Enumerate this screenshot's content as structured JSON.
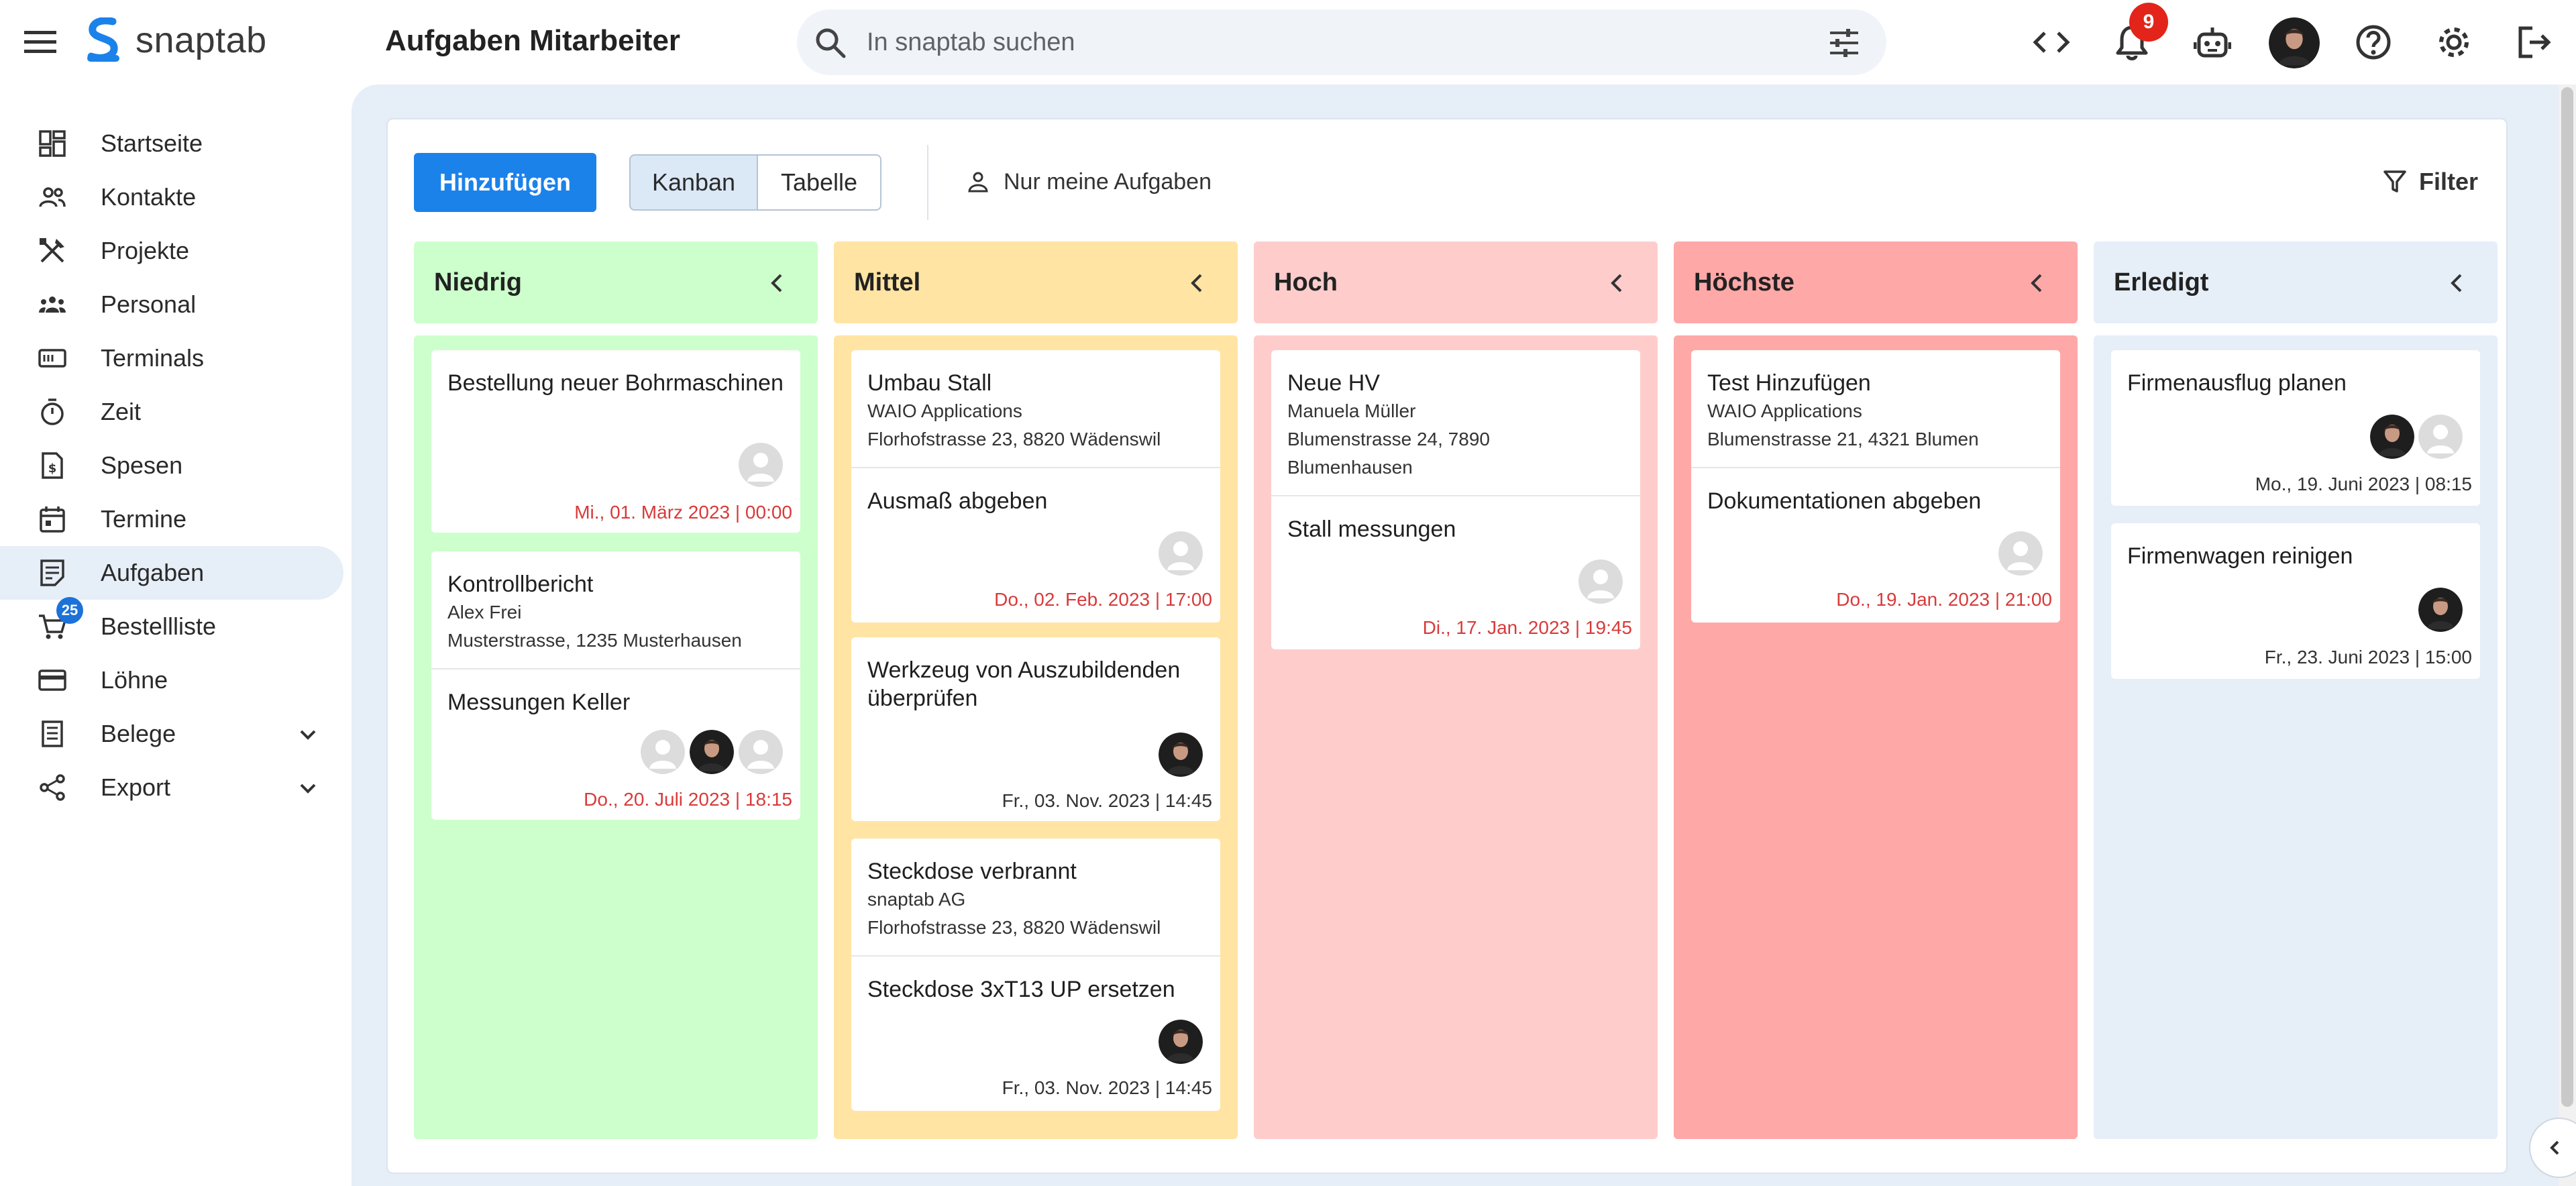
{
  "app": {
    "name": "snaptab",
    "page_title": "Aufgaben Mitarbeiter"
  },
  "search": {
    "placeholder": "In snaptab suchen"
  },
  "header": {
    "notification_count": "9"
  },
  "sidebar": {
    "items": [
      {
        "label": "Startseite",
        "icon": "dashboard-icon"
      },
      {
        "label": "Kontakte",
        "icon": "contacts-icon"
      },
      {
        "label": "Projekte",
        "icon": "tools-icon"
      },
      {
        "label": "Personal",
        "icon": "groups-icon"
      },
      {
        "label": "Terminals",
        "icon": "terminal-icon"
      },
      {
        "label": "Zeit",
        "icon": "timer-icon"
      },
      {
        "label": "Spesen",
        "icon": "receipt-icon"
      },
      {
        "label": "Termine",
        "icon": "calendar-icon"
      },
      {
        "label": "Aufgaben",
        "icon": "tasks-icon",
        "active": true
      },
      {
        "label": "Bestellliste",
        "icon": "cart-icon",
        "badge": "25"
      },
      {
        "label": "Löhne",
        "icon": "payment-card-icon"
      },
      {
        "label": "Belege",
        "icon": "document-icon",
        "expandable": true
      },
      {
        "label": "Export",
        "icon": "share-icon",
        "expandable": true
      }
    ]
  },
  "toolbar": {
    "add_label": "Hinzufügen",
    "view_kanban": "Kanban",
    "view_table": "Tabelle",
    "my_tasks": "Nur meine Aufgaben",
    "filter": "Filter"
  },
  "colors": {
    "niedrig": "#ccffcc",
    "mittel": "#ffe4a3",
    "hoch": "#ffcccc",
    "hoechste": "#ffa8a8",
    "erledigt": "#e6eef8",
    "accent": "#1b82ea",
    "overdue": "#d93a3a"
  },
  "columns": [
    {
      "title": "Niedrig",
      "cards": [
        {
          "title": "Bestellung neuer Bohrmaschinen",
          "date": "Mi., 01. März 2023 | 00:00"
        },
        {
          "title": "Kontrollbericht",
          "contact": "Alex Frei",
          "address": "Musterstrasse, 1235 Musterhausen",
          "task": "Messungen Keller",
          "date": "Do., 20. Juli 2023 | 18:15"
        }
      ]
    },
    {
      "title": "Mittel",
      "cards": [
        {
          "title": "Umbau Stall",
          "contact": "WAIO Applications",
          "address": "Florhofstrasse 23, 8820 Wädenswil",
          "task": "Ausmaß abgeben",
          "date": "Do., 02. Feb. 2023 | 17:00"
        },
        {
          "title": "Werkzeug von Auszubildenden überprüfen",
          "date": "Fr., 03. Nov. 2023 | 14:45"
        },
        {
          "title": "Steckdose verbrannt",
          "contact": "snaptab AG",
          "address": "Florhofstrasse 23, 8820 Wädenswil",
          "task": "Steckdose 3xT13 UP ersetzen",
          "date": "Fr., 03. Nov. 2023 | 14:45"
        }
      ]
    },
    {
      "title": "Hoch",
      "cards": [
        {
          "title": "Neue HV",
          "contact": "Manuela Müller",
          "address_l1": "Blumenstrasse 24, 7890",
          "address_l2": "Blumenhausen",
          "task": "Stall messungen",
          "date": "Di., 17. Jan. 2023 | 19:45"
        }
      ]
    },
    {
      "title": "Höchste",
      "cards": [
        {
          "title": "Test Hinzufügen",
          "contact": "WAIO Applications",
          "address": "Blumenstrasse 21, 4321 Blumen",
          "task": "Dokumentationen abgeben",
          "date": "Do., 19. Jan. 2023 | 21:00"
        }
      ]
    },
    {
      "title": "Erledigt",
      "cards": [
        {
          "title": "Firmenausflug planen",
          "date": "Mo., 19. Juni 2023 | 08:15"
        },
        {
          "title": "Firmenwagen reinigen",
          "date": "Fr., 23. Juni 2023 | 15:00"
        }
      ]
    }
  ]
}
